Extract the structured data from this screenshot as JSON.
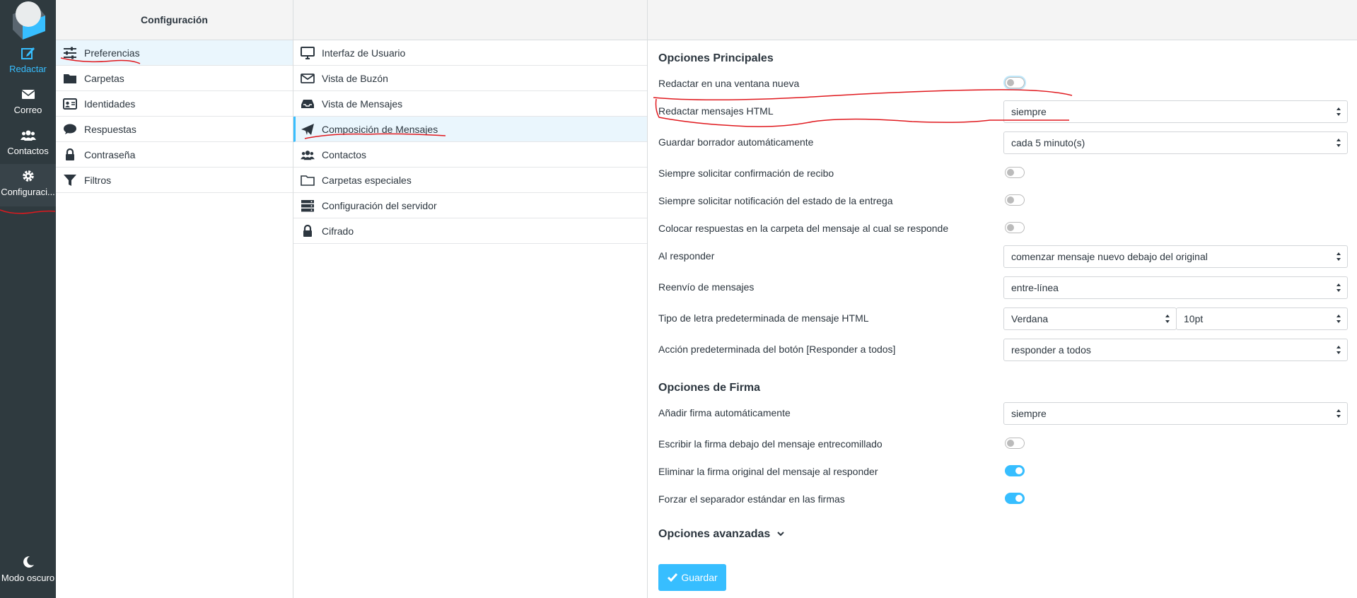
{
  "appbar": {
    "items": [
      {
        "label": "Redactar",
        "icon": "edit-icon"
      },
      {
        "label": "Correo",
        "icon": "envelope-icon"
      },
      {
        "label": "Contactos",
        "icon": "users-icon"
      },
      {
        "label": "Configuraci...",
        "icon": "gear-icon"
      },
      {
        "label": "Modo oscuro",
        "icon": "moon-icon"
      }
    ]
  },
  "settings": {
    "title": "Configuración",
    "items": [
      {
        "label": "Preferencias",
        "icon": "sliders-icon"
      },
      {
        "label": "Carpetas",
        "icon": "folder-icon"
      },
      {
        "label": "Identidades",
        "icon": "id-card-icon"
      },
      {
        "label": "Respuestas",
        "icon": "comment-icon"
      },
      {
        "label": "Contraseña",
        "icon": "lock-icon"
      },
      {
        "label": "Filtros",
        "icon": "filter-icon"
      }
    ]
  },
  "sections": {
    "items": [
      {
        "label": "Interfaz de Usuario",
        "icon": "desktop-icon"
      },
      {
        "label": "Vista de Buzón",
        "icon": "envelope-outline-icon"
      },
      {
        "label": "Vista de Mensajes",
        "icon": "inbox-icon"
      },
      {
        "label": "Composición de Mensajes",
        "icon": "paper-plane-icon"
      },
      {
        "label": "Contactos",
        "icon": "users-icon"
      },
      {
        "label": "Carpetas especiales",
        "icon": "folder-outline-icon"
      },
      {
        "label": "Configuración del servidor",
        "icon": "server-icon"
      },
      {
        "label": "Cifrado",
        "icon": "lock-icon"
      }
    ]
  },
  "form": {
    "main_title": "Opciones Principales",
    "rows": {
      "new_window": {
        "label": "Redactar en una ventana nueva",
        "on": false
      },
      "html": {
        "label": "Redactar mensajes HTML",
        "value": "siempre"
      },
      "draft": {
        "label": "Guardar borrador automáticamente",
        "value": "cada 5 minuto(s)"
      },
      "mdn": {
        "label": "Siempre solicitar confirmación de recibo",
        "on": false
      },
      "dsn": {
        "label": "Siempre solicitar notificación del estado de la entrega",
        "on": false
      },
      "reply_same": {
        "label": "Colocar respuestas en la carpeta del mensaje al cual se responde",
        "on": false
      },
      "reply_mode": {
        "label": "Al responder",
        "value": "comenzar mensaje nuevo debajo del original"
      },
      "forward": {
        "label": "Reenvío de mensajes",
        "value": "entre-línea"
      },
      "font": {
        "label": "Tipo de letra predeterminada de mensaje HTML",
        "value": "Verdana",
        "size": "10pt"
      },
      "reply_all": {
        "label": "Acción predeterminada del botón [Responder a todos]",
        "value": "responder a todos"
      }
    },
    "signature_title": "Opciones de Firma",
    "sig_rows": {
      "auto_sig": {
        "label": "Añadir firma automáticamente",
        "value": "siempre"
      },
      "sig_below": {
        "label": "Escribir la firma debajo del mensaje entrecomillado",
        "on": false
      },
      "strip_sig": {
        "label": "Eliminar la firma original del mensaje al responder",
        "on": true
      },
      "force_sep": {
        "label": "Forzar el separador estándar en las firmas",
        "on": true
      }
    },
    "advanced_title": "Opciones avanzadas",
    "save_label": "Guardar"
  },
  "colors": {
    "accent": "#37beff",
    "sidebar": "#2f3a3f",
    "annotation": "#e0191e"
  }
}
